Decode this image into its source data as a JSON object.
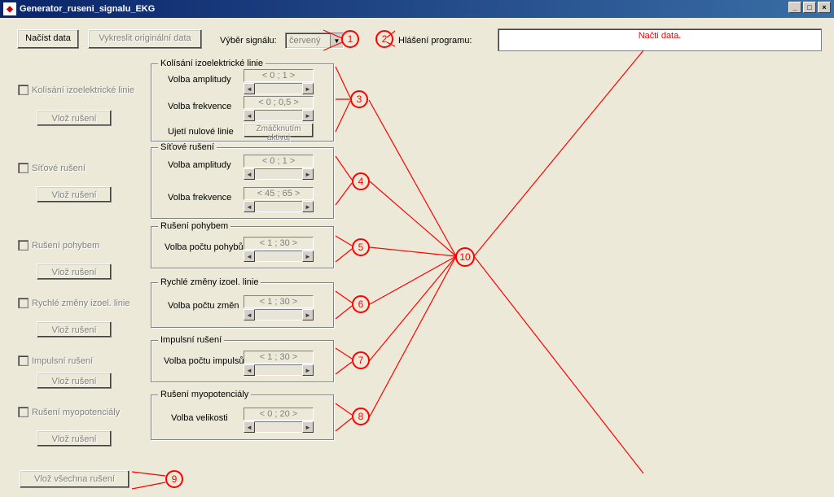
{
  "window": {
    "title": "Generator_ruseni_signalu_EKG"
  },
  "buttons": {
    "load_data": "Načíst data",
    "plot_original": "Vykreslit originální data",
    "insert_noise": "Vlož rušení",
    "insert_all": "Vlož všechna rušení",
    "activate_press": "Zmáčknutím aktivuj"
  },
  "labels": {
    "signal_select": "Výběr signálu:",
    "program_msg": "Hlášení programu:",
    "amplitude": "Volba amplitudy",
    "frequency": "Volba frekvence",
    "zero_line_shift": "Ujetí nulové linie",
    "move_count": "Volba počtu pohybů",
    "change_count": "Volba počtu změn",
    "impulse_count": "Volba počtu impulsů",
    "size": "Volba velikosti"
  },
  "dropdown": {
    "signal_value": "červený"
  },
  "checkboxes": {
    "baseline": "Kolísání izoelektrické linie",
    "mains": "Síťové rušení",
    "motion": "Rušení pohybem",
    "fast_changes": "Rychlé změny izoel. linie",
    "impulse": "Impulsní rušení",
    "myo": "Rušení myopotenciály"
  },
  "groups": {
    "baseline": "Kolísání izoelektrické linie",
    "mains": "Síťové rušení",
    "motion": "Rušení pohybem",
    "fast_changes": "Rychlé změny izoel. linie",
    "impulse": "Impulsní rušení",
    "myo": "Rušení myopotenciály"
  },
  "ranges": {
    "r01": "< 0 ; 1 >",
    "r005": "< 0 ; 0,5 >",
    "r4565": "< 45 ; 65 >",
    "r130": "< 1 ; 30 >",
    "r020": "< 0 ; 20 >"
  },
  "message": "Načti data.",
  "annotations": {
    "a1": "1",
    "a2": "2",
    "a3": "3",
    "a4": "4",
    "a5": "5",
    "a6": "6",
    "a7": "7",
    "a8": "8",
    "a9": "9",
    "a10": "10"
  }
}
